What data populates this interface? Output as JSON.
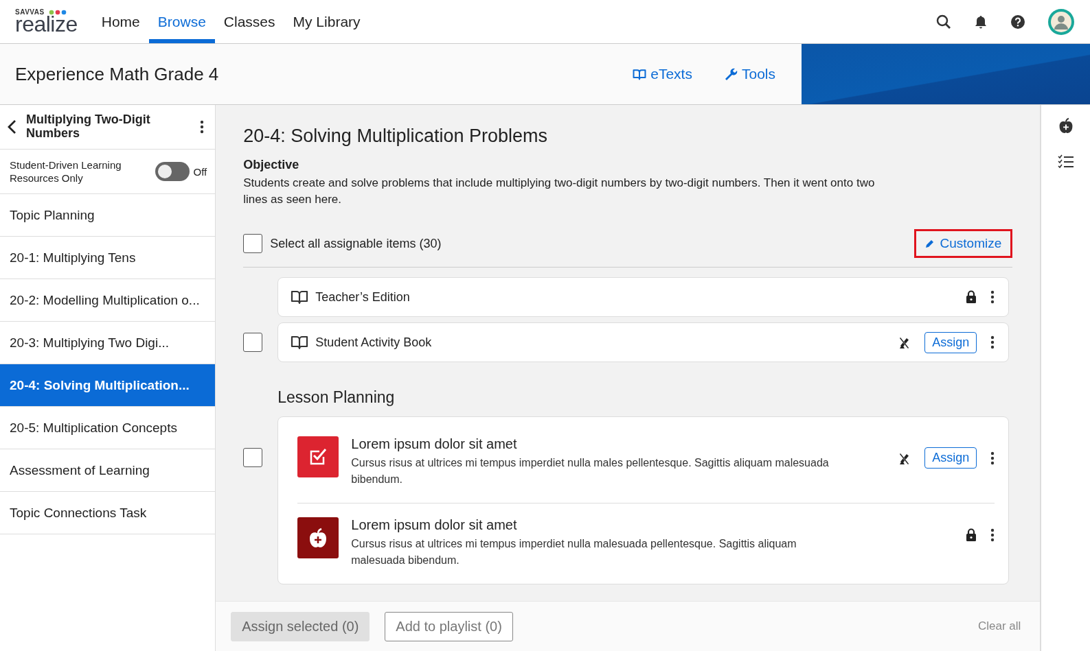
{
  "header": {
    "logo": {
      "small": "SAVVAS",
      "name": "realize"
    },
    "nav": [
      {
        "label": "Home",
        "selected": false
      },
      {
        "label": "Browse",
        "selected": true
      },
      {
        "label": "Classes",
        "selected": false
      },
      {
        "label": "My Library",
        "selected": false
      }
    ]
  },
  "course": {
    "title": "Experience Math Grade 4",
    "links": [
      {
        "label": "eTexts",
        "kind": "book"
      },
      {
        "label": "Tools",
        "kind": "wrench"
      }
    ]
  },
  "sidebar": {
    "title": "Multiplying Two-Digit Numbers",
    "toggle": {
      "label": "Student-Driven Learning Resources Only",
      "on": false,
      "state_text": "Off"
    },
    "items": [
      {
        "label": "Topic Planning",
        "selected": false
      },
      {
        "label": "20-1: Multiplying Tens",
        "selected": false
      },
      {
        "label": "20-2: Modelling Multiplication o...",
        "selected": false
      },
      {
        "label": "20-3: Multiplying Two Digi...",
        "selected": false
      },
      {
        "label": "20-4: Solving Multiplication...",
        "selected": true
      },
      {
        "label": "20-5: Multiplication Concepts",
        "selected": false
      },
      {
        "label": "Assessment of Learning",
        "selected": false
      },
      {
        "label": "Topic Connections Task",
        "selected": false
      }
    ]
  },
  "lesson": {
    "title": "20-4: Solving Multiplication Problems",
    "objective_label": "Objective",
    "objective": "Students create and solve problems that include multiplying two-digit numbers by two-digit numbers. Then it went onto two lines as seen here.",
    "select_all": {
      "label": "Select all assignable items (30)",
      "checked": false
    },
    "customize": {
      "label": "Customize",
      "highlighted": true
    },
    "resources": [
      {
        "title": "Teacher’s Edition",
        "assignable": false
      },
      {
        "title": "Student Activity Book",
        "checked": false,
        "assignable": true,
        "assign_label": "Assign"
      }
    ],
    "section": {
      "title": "Lesson Planning",
      "items": [
        {
          "kind": "assessment",
          "title": "Lorem ipsum dolor sit amet",
          "description": "Cursus risus at ultrices mi tempus imperdiet nulla males pellentesque. Sagittis aliquam malesuada bibendum.",
          "checked": false,
          "assignable": true,
          "assign_label": "Assign"
        },
        {
          "kind": "teacher-resource",
          "title": "Lorem ipsum dolor sit amet",
          "description": "Cursus risus at ultrices mi tempus imperdiet nulla malesuada pellentesque. Sagittis aliquam malesuada bibendum.",
          "assignable": false
        }
      ]
    }
  },
  "footer": {
    "assign_selected": {
      "label": "Assign selected (0)",
      "disabled": true
    },
    "add_to_playlist": {
      "label": "Add to playlist (0)"
    },
    "clear_all": "Clear all"
  }
}
